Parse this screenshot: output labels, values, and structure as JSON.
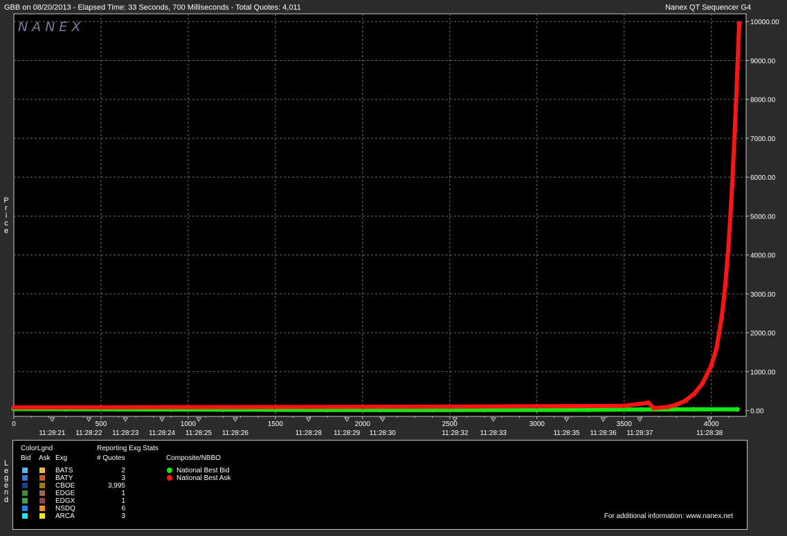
{
  "header": {
    "left": "GBB on 08/20/2013  -  Elapsed Time: 33 Seconds, 700 Milliseconds  -  Total Quotes: 4,011",
    "right": "Nanex QT Sequencer G4"
  },
  "watermark": "NANEX",
  "y_axis_title": [
    "P",
    "r",
    "i",
    "c",
    "e"
  ],
  "legend_side_title": [
    "L",
    "e",
    "g",
    "e",
    "n",
    "d"
  ],
  "colors": {
    "background": "#2b2b2b",
    "plot": "#000000",
    "grid": "#6e6e6e",
    "bid": "#14e614",
    "ask": "#ff1414"
  },
  "chart_data": {
    "type": "scatter",
    "xlim": [
      0,
      4200
    ],
    "ylim": [
      -150,
      10200
    ],
    "x_ticks": [
      0,
      500,
      1000,
      1500,
      2000,
      2500,
      3000,
      3500,
      4000
    ],
    "x_tick_labels": [
      "0",
      "500",
      "1000",
      "1500",
      "2000",
      "2500",
      "3000",
      "3500",
      "4000"
    ],
    "y_ticks": [
      0,
      1000,
      2000,
      3000,
      4000,
      5000,
      6000,
      7000,
      8000,
      9000,
      10000
    ],
    "y_tick_labels": [
      "0.00",
      "1000.00",
      "2000.00",
      "3000.00",
      "4000.00",
      "5000.00",
      "6000.00",
      "7000.00",
      "8000.00",
      "9000.00",
      "10000.00"
    ],
    "time_labels": [
      {
        "x": 220,
        "label": "11:28:21"
      },
      {
        "x": 430,
        "label": "11:28:22"
      },
      {
        "x": 640,
        "label": "11:28:23"
      },
      {
        "x": 850,
        "label": "11:28:24"
      },
      {
        "x": 1060,
        "label": "11:28:25"
      },
      {
        "x": 1270,
        "label": "11:28:26"
      },
      {
        "x": 1690,
        "label": "11:28:28"
      },
      {
        "x": 1910,
        "label": "11:28:29"
      },
      {
        "x": 2115,
        "label": "11:28:30"
      },
      {
        "x": 2530,
        "label": "11:28:32"
      },
      {
        "x": 2750,
        "label": "11:28:33"
      },
      {
        "x": 3170,
        "label": "11:28:35"
      },
      {
        "x": 3380,
        "label": "11:28:36"
      },
      {
        "x": 3590,
        "label": "11:28:37"
      },
      {
        "x": 3990,
        "label": "11:28:38"
      }
    ],
    "series": [
      {
        "name": "National Best Bid",
        "color": "#14e614",
        "x": [
          0,
          300,
          600,
          900,
          1200,
          1500,
          1800,
          2100,
          2400,
          2700,
          3000,
          3300,
          3600,
          3900,
          4150
        ],
        "y": [
          40,
          35,
          30,
          25,
          22,
          20,
          15,
          12,
          12,
          15,
          15,
          20,
          25,
          30,
          30
        ]
      },
      {
        "name": "National Best Ask",
        "color": "#ff1414",
        "x": [
          0,
          500,
          1000,
          1500,
          2000,
          2500,
          3000,
          3500,
          3640,
          3670,
          3750,
          3800,
          3850,
          3900,
          3950,
          4000,
          4030,
          4060,
          4080,
          4100,
          4120,
          4135,
          4150,
          4160
        ],
        "y": [
          80,
          82,
          85,
          90,
          95,
          100,
          110,
          120,
          200,
          60,
          90,
          150,
          250,
          420,
          700,
          1150,
          1600,
          2400,
          3200,
          4300,
          5800,
          7200,
          8800,
          9950
        ]
      }
    ]
  },
  "legend": {
    "col_headers": {
      "colorlgnd": "ColorLgnd",
      "bid": "Bid",
      "ask": "Ask",
      "exg": "Exg",
      "reporting": "Reporting Exg Stats",
      "quotes": "# Quotes",
      "composite": "Composite/NBBO"
    },
    "exchanges": [
      {
        "name": "BATS",
        "quotes": "2",
        "bid_color": "#5ab4e6",
        "ask_color": "#f0b450"
      },
      {
        "name": "BATY",
        "quotes": "3",
        "bid_color": "#3c78c8",
        "ask_color": "#c85a1e"
      },
      {
        "name": "CBOE",
        "quotes": "3,995",
        "bid_color": "#1e3c8c",
        "ask_color": "#a07814"
      },
      {
        "name": "EDGE",
        "quotes": "1",
        "bid_color": "#3c8c3c",
        "ask_color": "#a06450"
      },
      {
        "name": "EDGX",
        "quotes": "1",
        "bid_color": "#46a046",
        "ask_color": "#8c4650"
      },
      {
        "name": "NSDQ",
        "quotes": "6",
        "bid_color": "#1e82f0",
        "ask_color": "#f08c1e"
      },
      {
        "name": "ARCA",
        "quotes": "3",
        "bid_color": "#1ee6f0",
        "ask_color": "#f0e614"
      }
    ],
    "nbbo": [
      {
        "label": "National Best Bid",
        "color": "#14e614"
      },
      {
        "label": "National Best Ask",
        "color": "#ff1414"
      }
    ],
    "footer": "For additional information: www.nanex.net"
  }
}
